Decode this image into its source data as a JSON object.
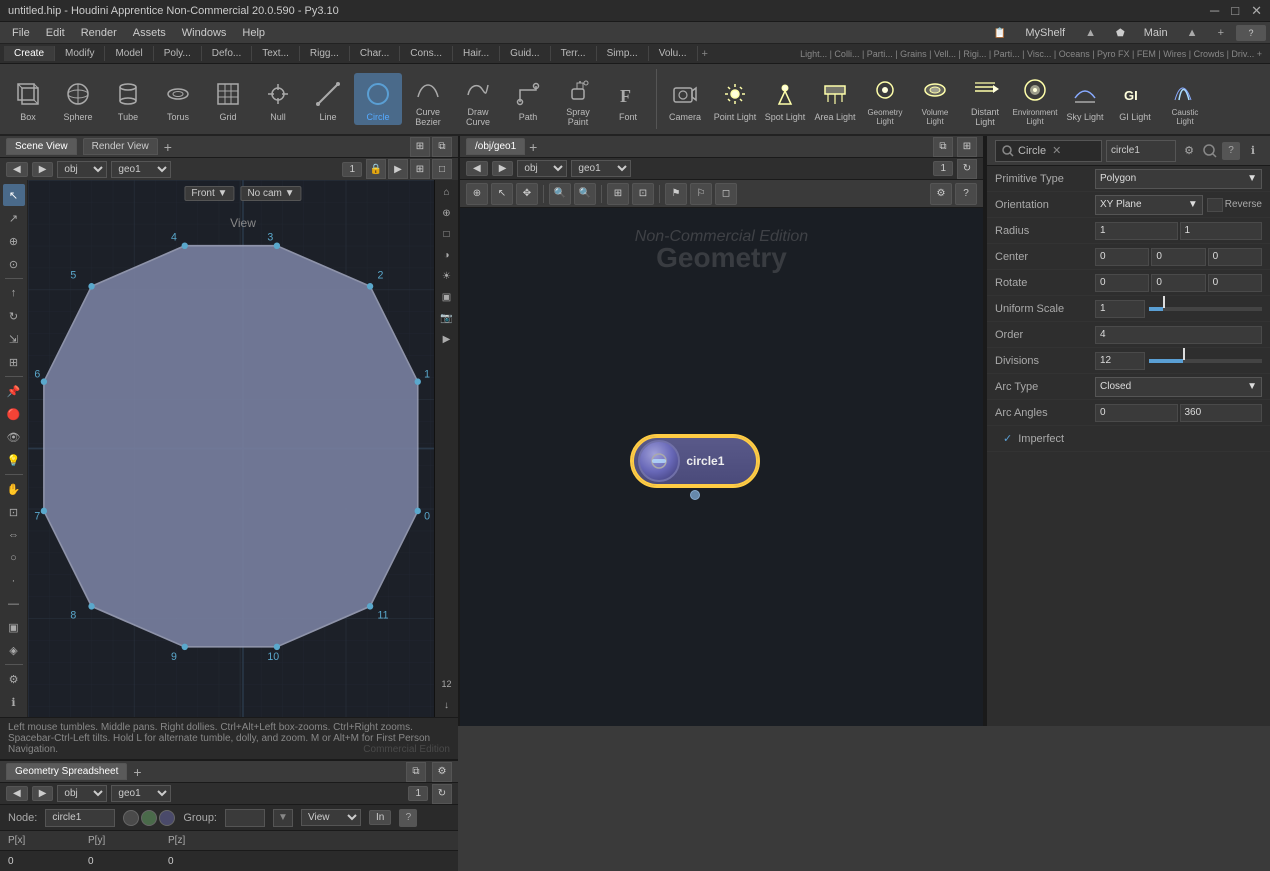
{
  "titlebar": {
    "title": "untitled.hip - Houdini Apprentice Non-Commercial 20.0.590 - Py3.10",
    "min": "─",
    "max": "□",
    "close": "✕"
  },
  "menubar": {
    "items": [
      "File",
      "Edit",
      "Render",
      "Assets",
      "Windows",
      "Help"
    ]
  },
  "shelf": {
    "create_label": "Create",
    "myshelf_label": "MyShelf",
    "main_label": "Main",
    "plus_label": "+"
  },
  "toolbar_tabs": {
    "items": [
      "Create",
      "Modify",
      "Model",
      "Poly...",
      "Defo...",
      "Text...",
      "Rigg...",
      "Char...",
      "Cons...",
      "Hair...",
      "Guid...",
      "Terr...",
      "Simp...",
      "Volu...",
      "+"
    ]
  },
  "toolbar_tools_row1": {
    "items": [
      {
        "id": "box",
        "label": "Box"
      },
      {
        "id": "sphere",
        "label": "Sphere"
      },
      {
        "id": "tube",
        "label": "Tube"
      },
      {
        "id": "torus",
        "label": "Torus"
      },
      {
        "id": "grid",
        "label": "Grid"
      },
      {
        "id": "null",
        "label": "Null"
      },
      {
        "id": "line",
        "label": "Line"
      },
      {
        "id": "circle",
        "label": "Circle"
      },
      {
        "id": "curvebezier",
        "label": "Curve Bezier"
      },
      {
        "id": "drawcurve",
        "label": "Draw Curve"
      },
      {
        "id": "path",
        "label": "Path"
      },
      {
        "id": "spraypaint",
        "label": "Spray Paint"
      },
      {
        "id": "font",
        "label": "Font"
      },
      {
        "id": "sep1",
        "label": ""
      },
      {
        "id": "camera",
        "label": "Camera"
      },
      {
        "id": "pointlight",
        "label": "Point Light"
      },
      {
        "id": "spotlight",
        "label": "Spot Light"
      },
      {
        "id": "arealight",
        "label": "Area Light"
      },
      {
        "id": "geolight",
        "label": "Geometry Light"
      },
      {
        "id": "volumelight",
        "label": "Volume Light"
      },
      {
        "id": "distantlight",
        "label": "Distant Light"
      },
      {
        "id": "envlight",
        "label": "Environment Light"
      },
      {
        "id": "skylight",
        "label": "Sky Light"
      },
      {
        "id": "gilight",
        "label": "GI Light"
      },
      {
        "id": "causticlight",
        "label": "Caustic Light"
      }
    ]
  },
  "scene_view": {
    "tab": "Scene View",
    "render_tab": "Render View",
    "view_mode": "Front",
    "cam_mode": "No cam",
    "path": "obj",
    "node": "geo1",
    "viewport_label": "View",
    "status_text": "Left mouse tumbles. Middle pans. Right dollies. Ctrl+Alt+Left box-zooms. Ctrl+Right zooms. Spacebar-Ctrl-Left tilts. Hold L for alternate tumble, dolly, and zoom. M or Alt+M for First Person Navigation.",
    "noncommer": "Commercial Edition",
    "points": [
      "0",
      "1",
      "2",
      "3",
      "4",
      "5",
      "6",
      "7",
      "8",
      "9",
      "10",
      "11"
    ]
  },
  "node_network": {
    "tab": "/obj/geo1",
    "path_obj": "obj",
    "path_geo": "geo1",
    "node_name": "circle1",
    "noncommer1": "Non-Commercial Edition",
    "noncommer2": "Geometry"
  },
  "properties": {
    "search_placeholder": "Circle",
    "node_name": "circle1",
    "primitive_type_label": "Primitive Type",
    "primitive_type_value": "Polygon",
    "orientation_label": "Orientation",
    "orientation_value": "XY Plane",
    "reverse_label": "Reverse",
    "radius_label": "Radius",
    "radius_val1": "1",
    "radius_val2": "1",
    "center_label": "Center",
    "center_val1": "0",
    "center_val2": "0",
    "center_val3": "0",
    "rotate_label": "Rotate",
    "rotate_val1": "0",
    "rotate_val2": "0",
    "rotate_val3": "0",
    "uniform_scale_label": "Uniform Scale",
    "uniform_scale_val": "1",
    "order_label": "Order",
    "order_val": "4",
    "divisions_label": "Divisions",
    "divisions_val": "12",
    "arc_type_label": "Arc Type",
    "arc_type_val": "Closed",
    "arc_angles_label": "Arc Angles",
    "arc_angles_val1": "0",
    "arc_angles_val2": "360",
    "imperfect_label": "Imperfect"
  },
  "bottom_panel": {
    "tab": "Geometry Spreadsheet",
    "path_obj": "obj",
    "path_geo": "geo1",
    "node_label": "Node:",
    "node_name": "circle1",
    "group_label": "Group:",
    "view_label": "View",
    "in_label": "In",
    "help_label": "?",
    "px_label": "P[x]",
    "py_label": "P[y]",
    "pz_label": "P[z]",
    "px_val": "0",
    "py_val": "0",
    "pz_val": "0"
  },
  "colors": {
    "accent_blue": "#5a9fd4",
    "bg_dark": "#1e2228",
    "bg_panel": "#2e2e2e",
    "bg_toolbar": "#3a3a3a",
    "node_border": "#ffcc44",
    "text_light": "#cccccc",
    "text_dim": "#888888"
  }
}
